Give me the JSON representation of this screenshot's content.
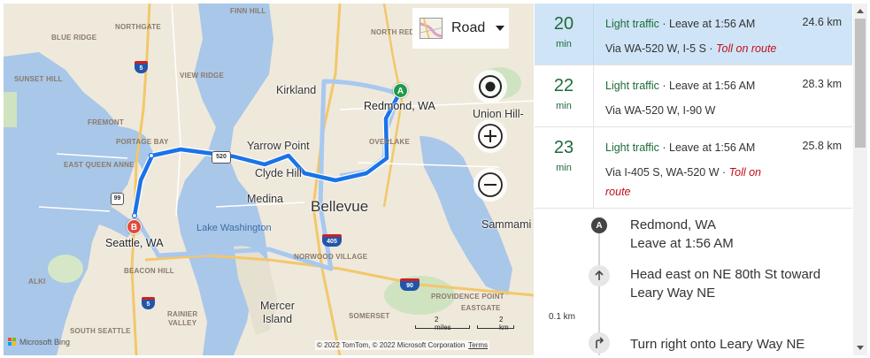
{
  "map": {
    "style_selector": {
      "label": "Road",
      "icon": "road-map-icon"
    },
    "controls": [
      {
        "name": "locate-me-button",
        "icon": "target-icon"
      },
      {
        "name": "zoom-in-button",
        "icon": "plus-icon"
      },
      {
        "name": "zoom-out-button",
        "icon": "minus-icon"
      }
    ],
    "places": {
      "finn_hill": "FINN HILL",
      "northgate": "NORTHGATE",
      "blue_ridge": "BLUE RIDGE",
      "north_redmond": "NORTH RED",
      "sunset_hill": "SUNSET HILL",
      "view_ridge": "VIEW RIDGE",
      "kirkland": "Kirkland",
      "redmond": "Redmond, WA",
      "union_hill": "Union Hill-",
      "fremont": "FREMONT",
      "portage_bay": "PORTAGE BAY",
      "east_queen_anne": "EAST QUEEN ANNE",
      "yarrow_point": "Yarrow Point",
      "clyde_hill": "Clyde Hill",
      "overlake": "OVERLAKE",
      "medina": "Medina",
      "bellevue": "Bellevue",
      "sammamish": "Sammami",
      "seattle": "Seattle, WA",
      "lake_washington": "Lake Washington",
      "norwood_village": "NORWOOD VILLAGE",
      "alki": "ALKI",
      "beacon_hill": "BEACON HILL",
      "providence_point": "PROVIDENCE POINT",
      "eastgate": "EASTGATE",
      "mercer_island": "Mercer\nIsland",
      "rainier_valley": "RAINIER\nVALLEY",
      "somerset": "SOMERSET",
      "south_seattle": "SOUTH SEATTLE"
    },
    "shields": {
      "i5_north": "5",
      "wa520": "520",
      "wa99": "99",
      "i405": "405",
      "i90": "90",
      "i5_south": "5"
    },
    "pins": {
      "start": "A",
      "end": "B"
    },
    "scale": {
      "miles": "2 miles",
      "km": "2 km"
    },
    "copyright": "© 2022 TomTom, © 2022 Microsoft Corporation",
    "terms": "Terms",
    "brand": "Microsoft Bing",
    "colors": {
      "route_primary": "#1a73e8",
      "route_alt": "#a8c8f0",
      "water": "#a9c7e8",
      "land": "#efe9dc"
    }
  },
  "routes": [
    {
      "minutes": "20",
      "unit": "min",
      "traffic": "Light traffic",
      "leave": "Leave at 1:56 AM",
      "distance": "24.6 km",
      "via": "Via WA-520 W, I-5 S",
      "toll": "Toll on route",
      "selected": true
    },
    {
      "minutes": "22",
      "unit": "min",
      "traffic": "Light traffic",
      "leave": "Leave at 1:56 AM",
      "distance": "28.3 km",
      "via": "Via WA-520 W, I-90 W",
      "toll": "",
      "selected": false
    },
    {
      "minutes": "23",
      "unit": "min",
      "traffic": "Light traffic",
      "leave": "Leave at 1:56 AM",
      "distance": "25.8 km",
      "via": "Via I-405 S, WA-520 W",
      "toll": "Toll on",
      "toll2": "route",
      "selected": false
    }
  ],
  "separator": " · ",
  "directions": {
    "start": {
      "marker": "A",
      "place": "Redmond, WA",
      "leave": "Leave at 1:56 AM"
    },
    "steps": [
      {
        "icon": "arrow-up-icon",
        "text1": "Head east on NE 80th St toward",
        "text2": "Leary Way NE",
        "distance": "0.1 km"
      },
      {
        "icon": "turn-right-icon",
        "text1": "Turn right onto Leary Way NE",
        "text2": "",
        "distance": ""
      }
    ]
  }
}
